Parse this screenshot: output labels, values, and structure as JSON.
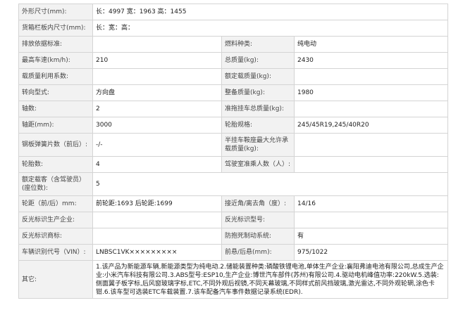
{
  "rows": [
    {
      "h": 23,
      "cells": [
        {
          "t": "k",
          "text": "外形尺寸(mm):"
        },
        {
          "t": "v",
          "text": "长：4997 宽：1963 高：1455",
          "span": 3
        }
      ]
    },
    {
      "h": 23,
      "cells": [
        {
          "t": "k",
          "text": "货箱栏板内尺寸(mm):"
        },
        {
          "t": "v",
          "text": "长：宽：高：",
          "span": 3
        }
      ]
    },
    {
      "h": 23,
      "cells": [
        {
          "t": "k",
          "text": "排放依据标准:"
        },
        {
          "t": "v",
          "text": ""
        },
        {
          "t": "k",
          "text": "燃料种类:"
        },
        {
          "t": "v",
          "text": "纯电动"
        }
      ]
    },
    {
      "h": 23,
      "cells": [
        {
          "t": "k",
          "text": "最高车速(km/h):"
        },
        {
          "t": "v",
          "text": "210"
        },
        {
          "t": "k",
          "text": "总质量(kg):"
        },
        {
          "t": "v",
          "text": "2430"
        }
      ]
    },
    {
      "h": 23,
      "cells": [
        {
          "t": "k",
          "text": "载质量利用系数:"
        },
        {
          "t": "v",
          "text": ""
        },
        {
          "t": "k",
          "text": "额定载质量(kg):"
        },
        {
          "t": "v",
          "text": ""
        }
      ]
    },
    {
      "h": 23,
      "cells": [
        {
          "t": "k",
          "text": "转向型式:"
        },
        {
          "t": "v",
          "text": "方向盘"
        },
        {
          "t": "k",
          "text": "整备质量(kg):"
        },
        {
          "t": "v",
          "text": "1980"
        }
      ]
    },
    {
      "h": 23,
      "cells": [
        {
          "t": "k",
          "text": "轴数:"
        },
        {
          "t": "v",
          "text": "2"
        },
        {
          "t": "k",
          "text": "准拖挂车总质量(kg):"
        },
        {
          "t": "v",
          "text": ""
        }
      ]
    },
    {
      "h": 23,
      "cells": [
        {
          "t": "k",
          "text": "轴距(mm):"
        },
        {
          "t": "v",
          "text": "3000"
        },
        {
          "t": "k",
          "text": "轮胎规格:"
        },
        {
          "t": "v",
          "text": "245/45R19,245/40R20"
        }
      ]
    },
    {
      "h": 33,
      "cells": [
        {
          "t": "k",
          "text": "钢板弹簧片数（前后）:"
        },
        {
          "t": "v",
          "text": "-/-"
        },
        {
          "t": "k",
          "text": "半挂车鞍座最大允许承载质量(kg):"
        },
        {
          "t": "v",
          "text": ""
        }
      ]
    },
    {
      "h": 23,
      "cells": [
        {
          "t": "k",
          "text": "轮胎数:"
        },
        {
          "t": "v",
          "text": "4"
        },
        {
          "t": "k",
          "text": "驾驶室准乘人数（人）:"
        },
        {
          "t": "v",
          "text": ""
        }
      ]
    },
    {
      "h": 33,
      "cells": [
        {
          "t": "k",
          "text": "额定载客（含驾驶员）(座位数):"
        },
        {
          "t": "v",
          "text": "5",
          "span": 3
        }
      ]
    },
    {
      "h": 23,
      "cells": [
        {
          "t": "k",
          "text": "轮距（前/后）mm:"
        },
        {
          "t": "v",
          "text": "前轮距:1693 后轮距:1699"
        },
        {
          "t": "k",
          "text": "接近角/离去角（度）:"
        },
        {
          "t": "v",
          "text": "14/16"
        }
      ]
    },
    {
      "h": 23,
      "cells": [
        {
          "t": "k",
          "text": "反光标识生产企业:"
        },
        {
          "t": "v",
          "text": ""
        },
        {
          "t": "k",
          "text": "反光标识型号:"
        },
        {
          "t": "v",
          "text": ""
        }
      ]
    },
    {
      "h": 23,
      "cells": [
        {
          "t": "k",
          "text": "反光标识商标:"
        },
        {
          "t": "v",
          "text": ""
        },
        {
          "t": "k",
          "text": "防抱死制动系统:"
        },
        {
          "t": "v",
          "text": "有"
        }
      ]
    },
    {
      "h": 23,
      "cells": [
        {
          "t": "k",
          "text": "车辆识别代号（VIN）:"
        },
        {
          "t": "v",
          "text": "LNBSC1VK×××××××××"
        },
        {
          "t": "k",
          "text": "前悬/后悬(mm):"
        },
        {
          "t": "v",
          "text": "975/1022"
        }
      ]
    },
    {
      "h": 54,
      "cells": [
        {
          "t": "k",
          "text": "其它:"
        },
        {
          "t": "v",
          "text": "1.该产品为新能源车辆,新能源类型为纯电动.2.储能装置种类:磷酸铁锂电池,单体生产企业:襄阳弗迪电池有限公司,总成生产企业:小米汽车科技有限公司.3.ABS型号:ESP10,生产企业:博世汽车部件(苏州)有限公司.4.驱动电机峰值功率:220kW.5.选装:侧面翼子板字标,后风窗玻璃字标,ETC,不同外观后视镜,不同天幕玻璃,不同样式前风挡玻璃,激光雷达,不同外观轮辋,涂色卡钳.6.该车型可选装ETC车载装置.7.该车配备汽车事件数据记录系统(EDR).",
          "span": 3,
          "note": true
        }
      ]
    }
  ]
}
